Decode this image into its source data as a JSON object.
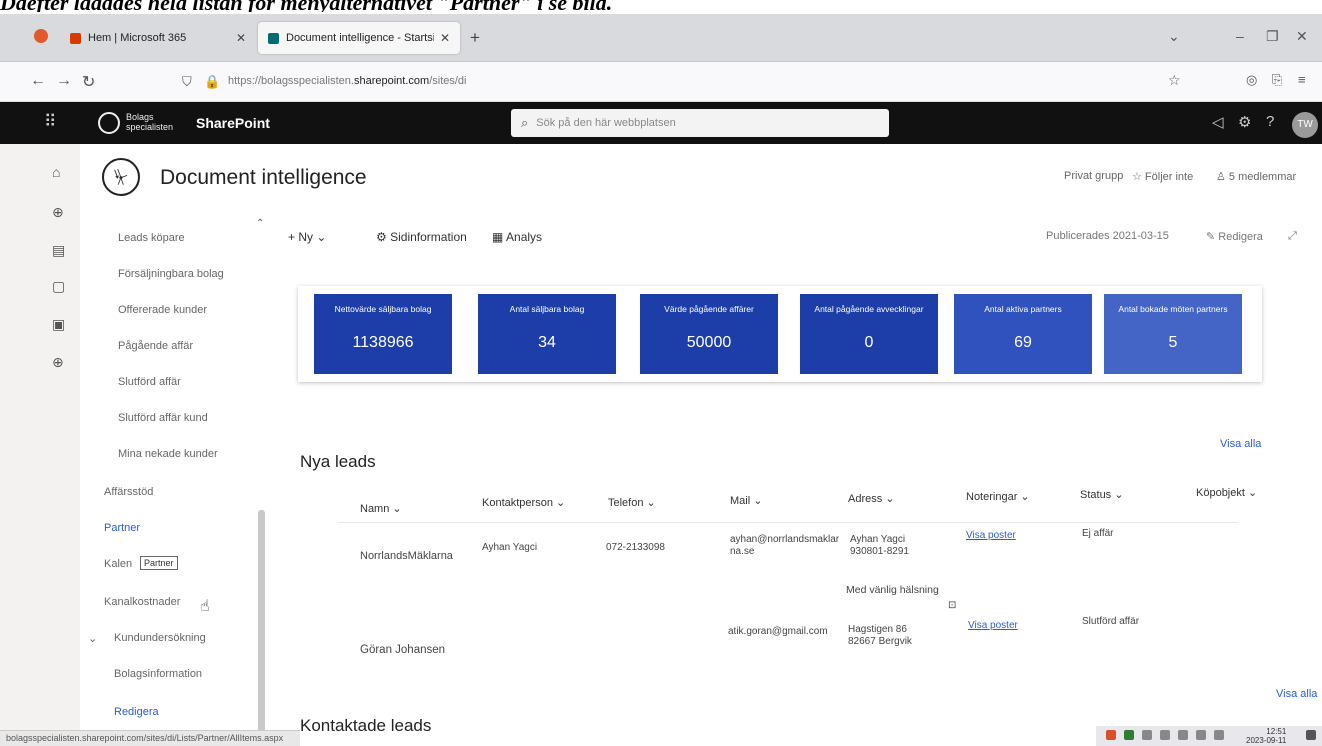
{
  "caption": "Däefter läaddes hela listan för menyalternativet \"Partner\" i se bild.",
  "browser": {
    "tabs": [
      {
        "label": "Hem | Microsoft 365",
        "icon": "m365-icon",
        "color": "#d83b01"
      },
      {
        "label": "Document intelligence - Startsi",
        "icon": "sharepoint-icon",
        "color": "#036c70"
      }
    ],
    "new_tab": "+",
    "url_prefix": "https://bolagsspecialisten.",
    "url_host": "sharepoint.com",
    "url_path": "/sites/di"
  },
  "suite": {
    "brand_line1": "Bolags",
    "brand_line2": "specialisten",
    "app_name": "SharePoint",
    "search_placeholder": "Sök på den här webbplatsen",
    "avatar_initials": "TW"
  },
  "site": {
    "title": "Document intelligence",
    "privacy": "Privat grupp",
    "follow": "Följer inte",
    "members": "5 medlemmar"
  },
  "commands": {
    "new": "Ny",
    "page_info": "Sidinformation",
    "analytics": "Analys",
    "published": "Publicerades 2021-03-15",
    "edit": "Redigera"
  },
  "nav": {
    "items": [
      {
        "label": "Leads köpare",
        "level": 1
      },
      {
        "label": "Försäljningbara bolag",
        "level": 1
      },
      {
        "label": "Offererade kunder",
        "level": 1
      },
      {
        "label": "Pågående affär",
        "level": 1
      },
      {
        "label": "Slutförd affär",
        "level": 1
      },
      {
        "label": "Slutförd affär kund",
        "level": 1
      },
      {
        "label": "Mina nekade kunder",
        "level": 1
      },
      {
        "label": "Affärsstöd",
        "level": 0
      },
      {
        "label": "Partner",
        "level": 0,
        "active": true
      },
      {
        "label": "Kalen",
        "level": 0
      },
      {
        "label": "Kanalkostnader",
        "level": 0
      },
      {
        "label": "Kundundersökning",
        "level": 0,
        "expander": true
      },
      {
        "label": "Bolagsinformation",
        "level": 0
      },
      {
        "label": "Redigera",
        "level": 0,
        "active": true
      }
    ],
    "tooltip": "Partner"
  },
  "kpis": [
    {
      "label": "Nettovärde säljbara bolag",
      "value": "1138966"
    },
    {
      "label": "Antal säljbara bolag",
      "value": "34"
    },
    {
      "label": "Värde pågående affärer",
      "value": "50000"
    },
    {
      "label": "Antal pågående avvecklingar",
      "value": "0"
    },
    {
      "label": "Antal aktiva partners",
      "value": "69"
    },
    {
      "label": "Antal bokade möten partners",
      "value": "5"
    }
  ],
  "accent_color": "#1d3ea8",
  "nya_leads": {
    "title": "Nya leads",
    "see_all": "Visa alla",
    "columns": [
      "Namn",
      "Kontaktperson",
      "Telefon",
      "Mail",
      "Adress",
      "Noteringar",
      "Status",
      "Köpobjekt"
    ],
    "rows": [
      {
        "name": "NorrlandsMäklarna",
        "contact": "Ayhan Yagci",
        "phone": "072-2133098",
        "mail": "ayhan@norrlandsmaklar na.se",
        "address": "Ayhan Yagci 930801-8291",
        "address_extra": "Med vänlig hälsning",
        "notes": "Visa poster",
        "status": "Ej affär"
      },
      {
        "name": "Göran Johansen",
        "contact": "",
        "phone": "",
        "mail": "atik.goran@gmail.com",
        "address": "Hagstigen 86 82667 Bergvik",
        "notes": "Visa poster",
        "status": "Slutförd affär"
      }
    ]
  },
  "kontaktade": {
    "title": "Kontaktade leads",
    "see_all": "Visa alla"
  },
  "status_url": "bolagsspecialisten.sharepoint.com/sites/di/Lists/Partner/AllItems.aspx",
  "clock": {
    "time": "12:51",
    "date": "2023-09-11"
  }
}
